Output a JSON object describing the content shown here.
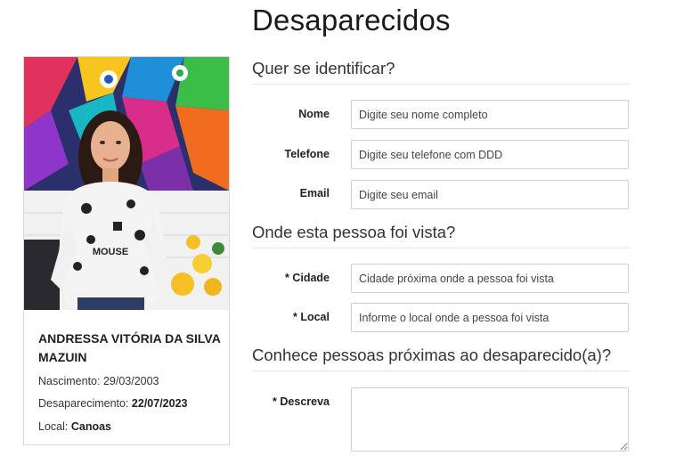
{
  "page": {
    "title": "Desaparecidos"
  },
  "card": {
    "name": "ANDRESSA VITÓRIA DA SILVA MAZUIN",
    "birth_label": "Nascimento: ",
    "birth_value": "29/03/2003",
    "missing_label": "Desaparecimento: ",
    "missing_value": "22/07/2023",
    "local_label": "Local: ",
    "local_value": "Canoas",
    "shirt_text": "MOUSE"
  },
  "sections": {
    "identify": {
      "title": "Quer se identificar?"
    },
    "seen": {
      "title": "Onde esta pessoa foi vista?"
    },
    "known": {
      "title": "Conhece pessoas próximas ao desaparecido(a)?"
    }
  },
  "fields": {
    "nome": {
      "label": "Nome",
      "placeholder": "Digite seu nome completo"
    },
    "telefone": {
      "label": "Telefone",
      "placeholder": "Digite seu telefone com DDD"
    },
    "email": {
      "label": "Email",
      "placeholder": "Digite seu email"
    },
    "cidade": {
      "label": "* Cidade",
      "placeholder": "Cidade próxima onde a pessoa foi vista"
    },
    "local": {
      "label": "* Local",
      "placeholder": "Informe o local onde a pessoa foi vista"
    },
    "descreva": {
      "label": "* Descreva",
      "placeholder": ""
    }
  }
}
